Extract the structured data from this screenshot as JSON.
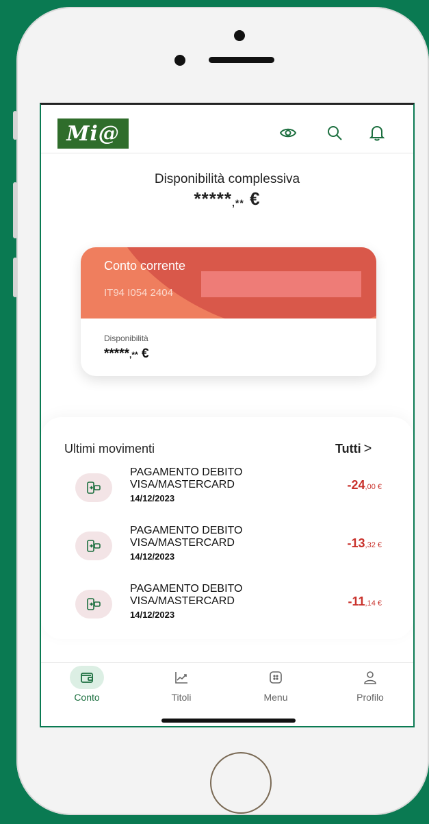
{
  "colors": {
    "brand_green": "#0a7a52",
    "card_orange": "#ef7e5e",
    "card_red": "#d9584a",
    "amount_red": "#c9322c"
  },
  "header": {
    "logo_text": "Mi@",
    "icons": [
      "eye-icon",
      "search-icon",
      "bell-icon"
    ]
  },
  "summary": {
    "label": "Disponibilità complessiva",
    "masked_int": "*****",
    "masked_dec": ",**",
    "currency": "€"
  },
  "card": {
    "title": "Conto corrente",
    "iban": "IT94 I054 2404",
    "available_label": "Disponibilità",
    "masked_int": "*****",
    "masked_dec": ",**",
    "currency": "€"
  },
  "movements": {
    "title": "Ultimi movimenti",
    "see_all": "Tutti",
    "items": [
      {
        "line1": "PAGAMENTO DEBITO",
        "line2": "VISA/MASTERCARD",
        "date": "14/12/2023",
        "amount_int": "-24",
        "amount_dec": ",00 €"
      },
      {
        "line1": "PAGAMENTO DEBITO",
        "line2": "VISA/MASTERCARD",
        "date": "14/12/2023",
        "amount_int": "-13",
        "amount_dec": ",32 €"
      },
      {
        "line1": "PAGAMENTO DEBITO",
        "line2": "VISA/MASTERCARD",
        "date": "14/12/2023",
        "amount_int": "-11",
        "amount_dec": ",14 €"
      }
    ]
  },
  "tabs": [
    {
      "label": "Conto",
      "icon": "wallet-icon",
      "active": true
    },
    {
      "label": "Titoli",
      "icon": "chart-icon",
      "active": false
    },
    {
      "label": "Menu",
      "icon": "menu-icon",
      "active": false
    },
    {
      "label": "Profilo",
      "icon": "user-icon",
      "active": false
    }
  ]
}
